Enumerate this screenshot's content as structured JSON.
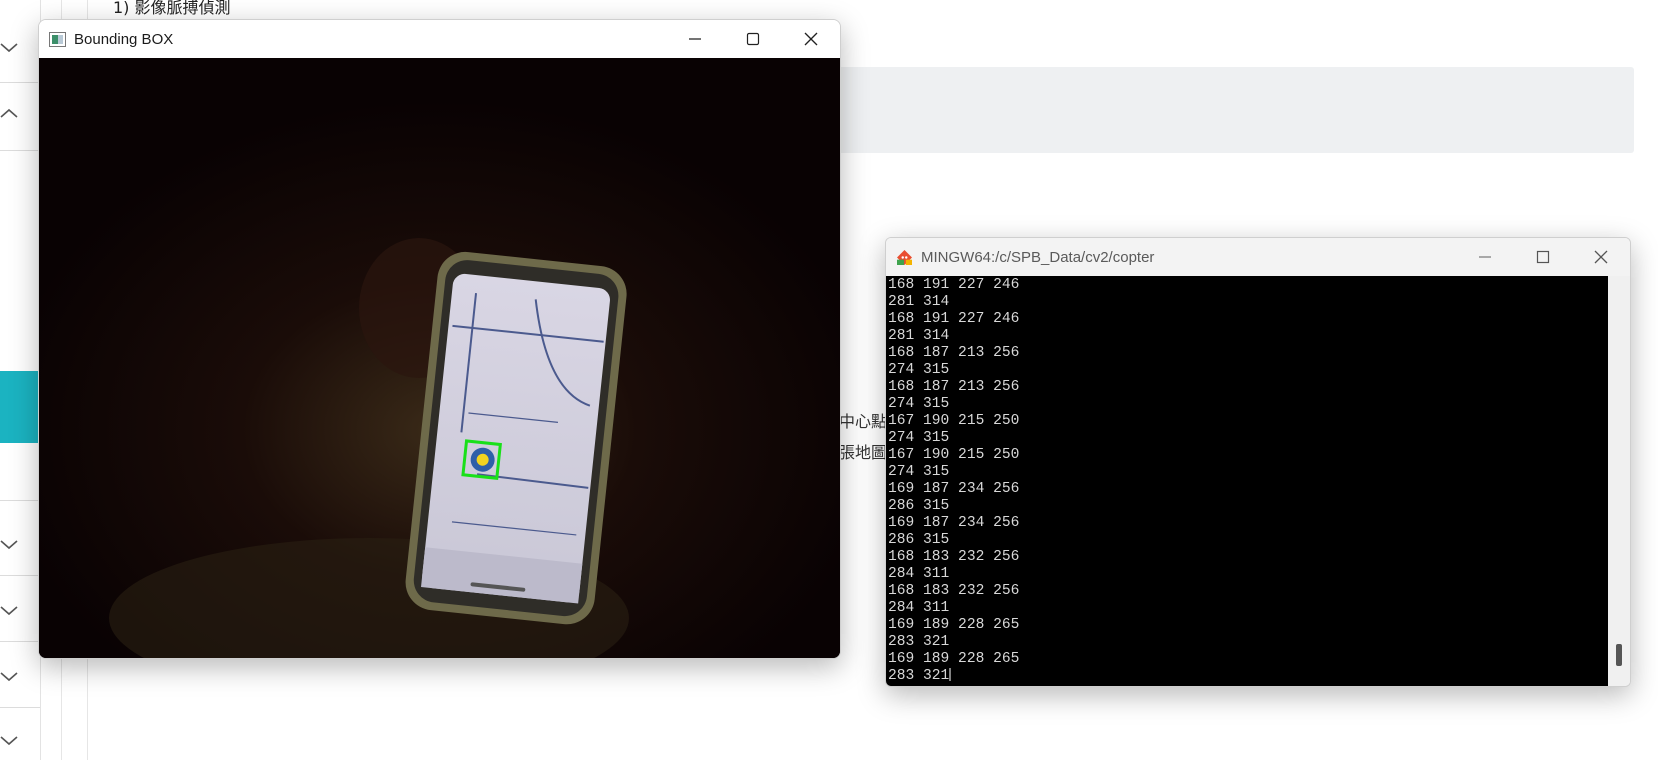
{
  "background_page": {
    "heading": "1) 影像脈搏偵測",
    "fragment_line1": "示中心點",
    "fragment_line2": "整張地圖"
  },
  "bbox_window": {
    "title": "Bounding BOX",
    "minimize_icon": "minimize-icon",
    "maximize_icon": "maximize-icon",
    "close_icon": "close-icon",
    "detection_box_color": "#19e019"
  },
  "terminal_window": {
    "title": "MINGW64:/c/SPB_Data/cv2/copter",
    "lines": [
      "168 191 227 246",
      "281 314",
      "168 191 227 246",
      "281 314",
      "168 187 213 256",
      "274 315",
      "168 187 213 256",
      "274 315",
      "167 190 215 250",
      "274 315",
      "167 190 215 250",
      "274 315",
      "169 187 234 256",
      "286 315",
      "169 187 234 256",
      "286 315",
      "168 183 232 256",
      "284 311",
      "168 183 232 256",
      "284 311",
      "169 189 228 265",
      "283 321",
      "169 189 228 265",
      "283 321"
    ]
  },
  "colors": {
    "accent_tab": "#1bb3c1",
    "terminal_bg": "#000000",
    "terminal_fg": "#d8d8d8"
  }
}
